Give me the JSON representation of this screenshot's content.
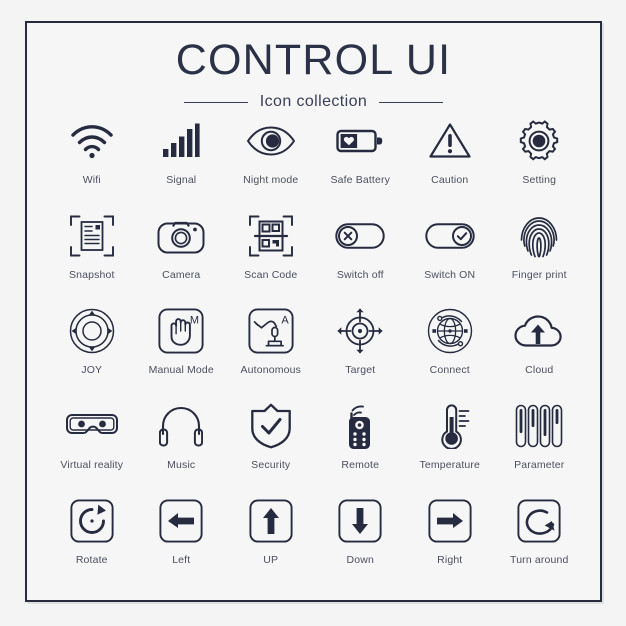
{
  "header": {
    "title": "CONTROL UI",
    "subtitle": "Icon collection"
  },
  "colors": {
    "ink": "#262b40",
    "caption": "#4b5060",
    "page_background": "#f4f4f4",
    "frame_background": "#f6f6f6",
    "frame_border": "#262b40"
  },
  "grid": {
    "columns": 6,
    "rows": 5
  },
  "icons": [
    {
      "label": "Wifi",
      "icon": "wifi-icon"
    },
    {
      "label": "Signal",
      "icon": "signal-bars-icon"
    },
    {
      "label": "Night mode",
      "icon": "eye-night-mode-icon"
    },
    {
      "label": "Safe Battery",
      "icon": "battery-heart-icon"
    },
    {
      "label": "Caution",
      "icon": "warning-triangle-icon"
    },
    {
      "label": "Setting",
      "icon": "gear-icon"
    },
    {
      "label": "Snapshot",
      "icon": "snapshot-document-icon"
    },
    {
      "label": "Camera",
      "icon": "camera-icon"
    },
    {
      "label": "Scan Code",
      "icon": "qr-scan-icon"
    },
    {
      "label": "Switch off",
      "icon": "toggle-off-icon"
    },
    {
      "label": "Switch ON",
      "icon": "toggle-on-icon"
    },
    {
      "label": "Finger print",
      "icon": "fingerprint-icon"
    },
    {
      "label": "JOY",
      "icon": "joystick-icon"
    },
    {
      "label": "Manual Mode",
      "icon": "hand-manual-mode-icon"
    },
    {
      "label": "Autonomous",
      "icon": "robot-arm-icon"
    },
    {
      "label": "Target",
      "icon": "crosshair-target-icon"
    },
    {
      "label": "Connect",
      "icon": "globe-orbit-connect-icon"
    },
    {
      "label": "Cloud",
      "icon": "cloud-upload-icon"
    },
    {
      "label": "Virtual reality",
      "icon": "vr-goggles-icon"
    },
    {
      "label": "Music",
      "icon": "headphones-icon"
    },
    {
      "label": "Security",
      "icon": "shield-check-icon"
    },
    {
      "label": "Remote",
      "icon": "remote-control-icon"
    },
    {
      "label": "Temperature",
      "icon": "thermometer-icon"
    },
    {
      "label": "Parameter",
      "icon": "sliders-icon"
    },
    {
      "label": "Rotate",
      "icon": "rotate-cw-icon"
    },
    {
      "label": "Left",
      "icon": "arrow-left-icon"
    },
    {
      "label": "UP",
      "icon": "arrow-up-icon"
    },
    {
      "label": "Down",
      "icon": "arrow-down-icon"
    },
    {
      "label": "Right",
      "icon": "arrow-right-icon"
    },
    {
      "label": "Turn around",
      "icon": "turn-around-icon"
    }
  ]
}
